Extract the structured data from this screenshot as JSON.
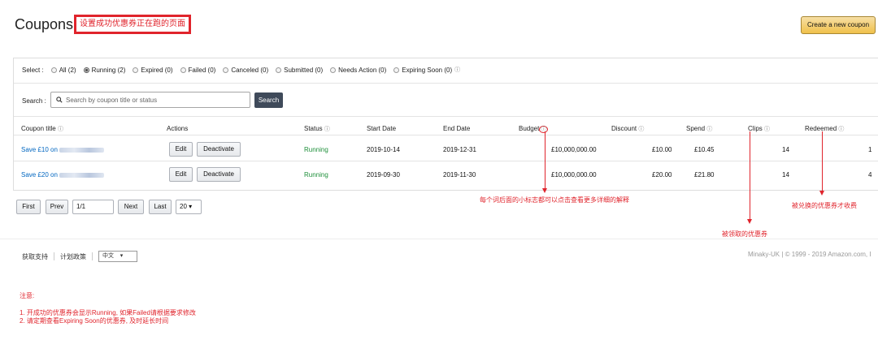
{
  "header": {
    "title": "Coupons",
    "annotation": "设置成功优惠券正在跑的页面",
    "create_button": "Create a new coupon"
  },
  "filters": {
    "label": "Select :",
    "options": [
      {
        "label": "All (2)",
        "selected": false
      },
      {
        "label": "Running (2)",
        "selected": true
      },
      {
        "label": "Expired (0)",
        "selected": false
      },
      {
        "label": "Failed (0)",
        "selected": false
      },
      {
        "label": "Canceled (0)",
        "selected": false
      },
      {
        "label": "Submitted (0)",
        "selected": false
      },
      {
        "label": "Needs Action (0)",
        "selected": false
      },
      {
        "label": "Expiring Soon (0)",
        "selected": false
      }
    ],
    "info_icon": "info-icon"
  },
  "search": {
    "label": "Search :",
    "placeholder": "Search by coupon title or status",
    "button": "Search"
  },
  "table": {
    "headers": [
      "Coupon title",
      "Actions",
      "Status",
      "Start Date",
      "End Date",
      "Budget",
      "Discount",
      "Spend",
      "Clips",
      "Redeemed"
    ],
    "rows": [
      {
        "title": "Save £10 on",
        "edit": "Edit",
        "deactivate": "Deactivate",
        "status": "Running",
        "start": "2019-10-14",
        "end": "2019-12-31",
        "budget": "£10,000,000.00",
        "discount": "£10.00",
        "spend": "£10.45",
        "clips": "14",
        "redeemed": "1"
      },
      {
        "title": "Save £20 on",
        "edit": "Edit",
        "deactivate": "Deactivate",
        "status": "Running",
        "start": "2019-09-30",
        "end": "2019-11-30",
        "budget": "£10,000,000.00",
        "discount": "£20.00",
        "spend": "£21.80",
        "clips": "14",
        "redeemed": "4"
      }
    ]
  },
  "pagination": {
    "first": "First",
    "prev": "Prev",
    "page": "1/1",
    "next": "Next",
    "last": "Last",
    "page_size": "20"
  },
  "annotations": {
    "budget_note": "每个词后面的小标志都可以点击查看更多详细的解释",
    "redeemed_note": "被兑换的优惠券才收费",
    "clips_note": "被领取的优惠券"
  },
  "footer": {
    "support": "获取支持",
    "policy": "计划政策",
    "language": "中文",
    "copyright": "Minaky-UK  |  © 1999 - 2019 Amazon.com, I"
  },
  "notes": {
    "heading": "注意:",
    "items": [
      "1. 开成功的优惠券会显示Running, 如果Failed请根据要求修改",
      "2. 请定期查看Expiring Soon的优惠券, 及时延长时间"
    ]
  },
  "colors": {
    "annotation_red": "#e0242c",
    "link_blue": "#0066c0",
    "running_green": "#1e8f3a",
    "primary_button": "#f0c14b",
    "search_button": "#3f4a5a"
  }
}
